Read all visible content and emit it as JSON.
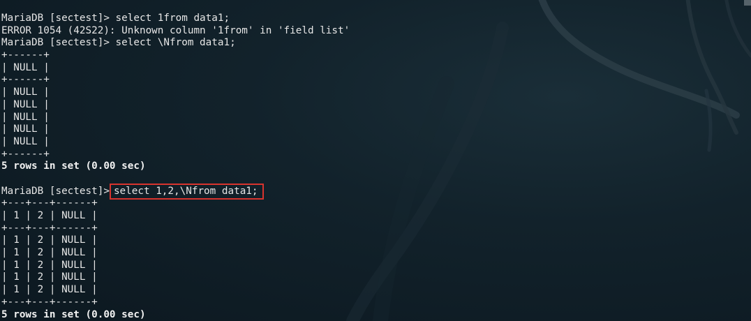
{
  "terminal": {
    "lines": [
      {
        "text": "MariaDB [sectest]> select 1from data1;"
      },
      {
        "text": "ERROR 1054 (42S22): Unknown column '1from' in 'field list'"
      },
      {
        "text": "MariaDB [sectest]> select \\Nfrom data1;"
      },
      {
        "text": "+------+"
      },
      {
        "text": "| NULL |"
      },
      {
        "text": "+------+"
      },
      {
        "text": "| NULL |"
      },
      {
        "text": "| NULL |"
      },
      {
        "text": "| NULL |"
      },
      {
        "text": "| NULL |"
      },
      {
        "text": "| NULL |"
      },
      {
        "text": "+------+"
      },
      {
        "text": "5 rows in set (0.00 sec)",
        "bold": true
      },
      {
        "text": ""
      },
      {
        "prompt": "MariaDB [sectest]>",
        "command": "select 1,2,\\Nfrom data1;",
        "highlight": true
      },
      {
        "text": "+---+---+------+"
      },
      {
        "text": "| 1 | 2 | NULL |"
      },
      {
        "text": "+---+---+------+"
      },
      {
        "text": "| 1 | 2 | NULL |"
      },
      {
        "text": "| 1 | 2 | NULL |"
      },
      {
        "text": "| 1 | 2 | NULL |"
      },
      {
        "text": "| 1 | 2 | NULL |"
      },
      {
        "text": "| 1 | 2 | NULL |"
      },
      {
        "text": "+---+---+------+"
      },
      {
        "text": "5 rows in set (0.00 sec)",
        "bold": true
      }
    ]
  },
  "colors": {
    "background": "#12222b",
    "text": "#e6e6e6",
    "highlight_box": "#d8342e"
  },
  "icons": {
    "wallpaper": "kali-dragon-wallpaper"
  }
}
